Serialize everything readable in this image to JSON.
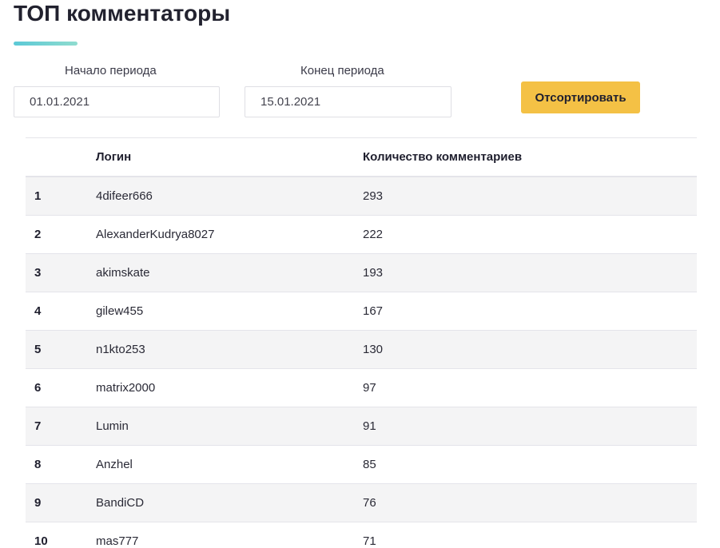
{
  "header": {
    "title": "ТОП комментаторы"
  },
  "filters": {
    "start_label": "Начало периода",
    "start_value": "01.01.2021",
    "end_label": "Конец периода",
    "end_value": "15.01.2021",
    "sort_label": "Отсортировать"
  },
  "table": {
    "columns": [
      "",
      "Логин",
      "Количество комментариев"
    ],
    "rows": [
      {
        "rank": "1",
        "login": "4difeer666",
        "count": "293"
      },
      {
        "rank": "2",
        "login": "AlexanderKudrya8027",
        "count": "222"
      },
      {
        "rank": "3",
        "login": "akimskate",
        "count": "193"
      },
      {
        "rank": "4",
        "login": "gilew455",
        "count": "167"
      },
      {
        "rank": "5",
        "login": "n1kto253",
        "count": "130"
      },
      {
        "rank": "6",
        "login": "matrix2000",
        "count": "97"
      },
      {
        "rank": "7",
        "login": "Lumin",
        "count": "91"
      },
      {
        "rank": "8",
        "login": "Anzhel",
        "count": "85"
      },
      {
        "rank": "9",
        "login": "BandiCD",
        "count": "76"
      },
      {
        "rank": "10",
        "login": "mas777",
        "count": "71"
      }
    ]
  },
  "colors": {
    "accent_button": "#f4c145",
    "underline_start": "#5bc9d6",
    "underline_end": "#8fdccf",
    "row_stripe": "#f4f4f5"
  }
}
